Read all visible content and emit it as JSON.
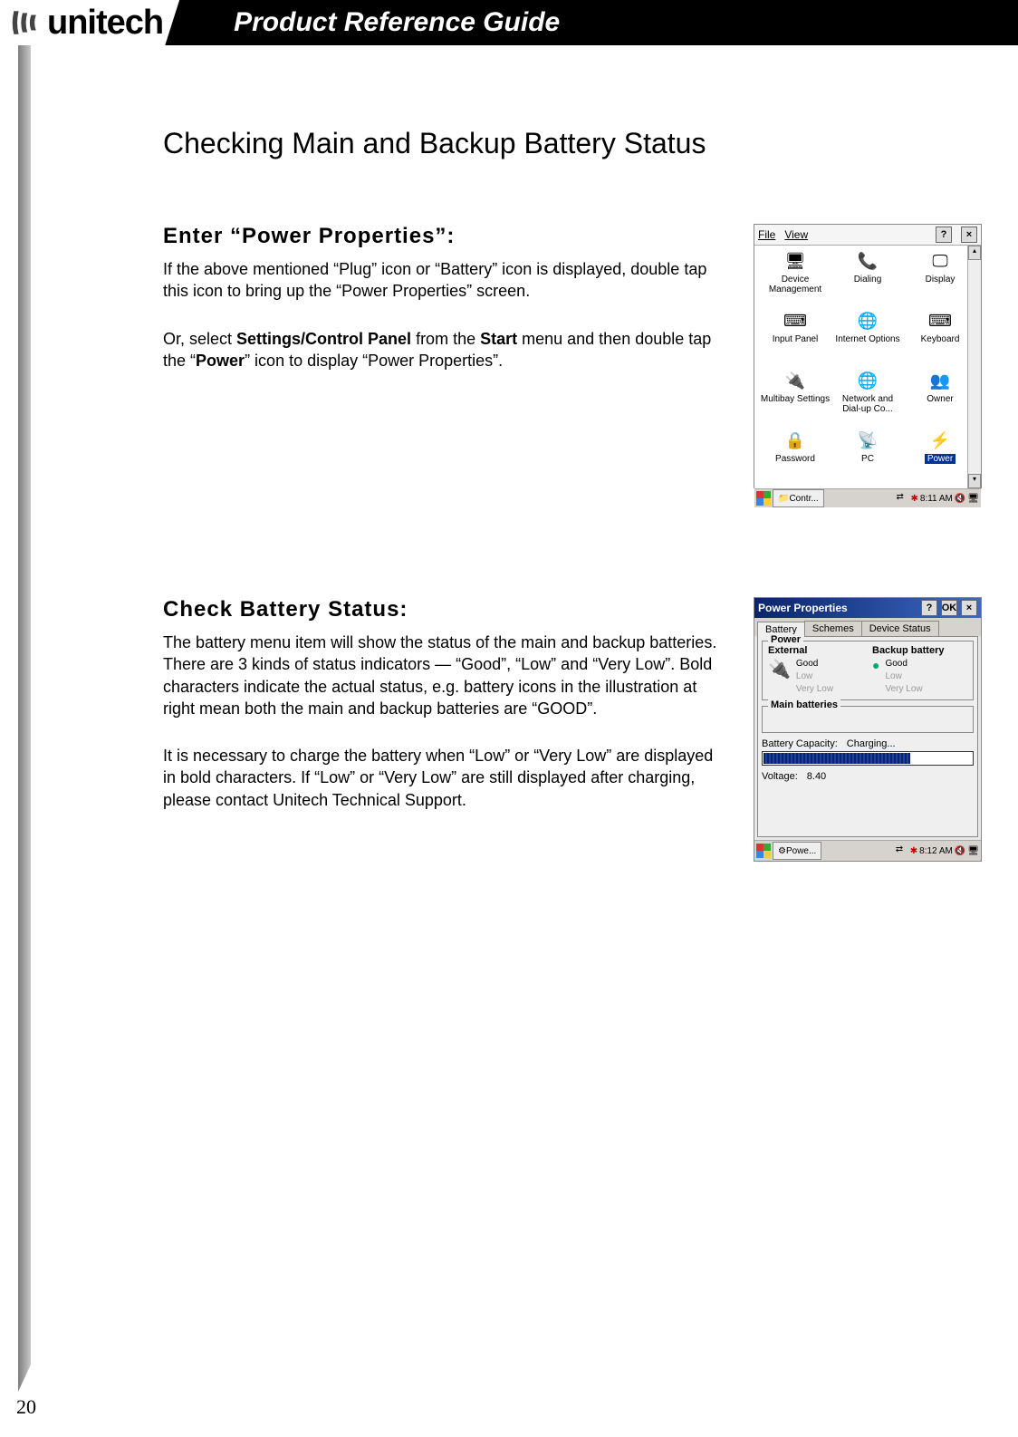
{
  "header": {
    "brand": "unitech",
    "title": "Product Reference Guide"
  },
  "page": {
    "number": "20",
    "heading": "Checking Main and Backup Battery Status"
  },
  "section1": {
    "title": "Enter “Power Properties”:",
    "para1": "If the above mentioned “Plug” icon or “Battery” icon is displayed, double tap this icon to bring up the “Power Properties” screen.",
    "para2_pre": "Or, select ",
    "para2_b1": "Settings/Control Panel",
    "para2_mid": " from the ",
    "para2_b2": "Start",
    "para2_mid2": " menu and then double tap the “",
    "para2_b3": "Power",
    "para2_post": "” icon to display “Power Properties”."
  },
  "section2": {
    "title": "Check Battery Status:",
    "para1": "The battery menu item will show the status of the main and backup batteries.  There are 3 kinds of status indicators — “Good”, “Low” and “Very Low”. Bold characters indicate the actual status, e.g. battery icons in the illustration at right mean both the main and backup batteries are “GOOD”.",
    "para2": "It is necessary to charge the battery when “Low” or “Very Low” are displayed in bold characters.  If “Low” or “Very Low” are still displayed after charging, please contact Unitech Technical Support."
  },
  "shot1": {
    "menu": {
      "file": "File",
      "view": "View",
      "help": "?",
      "close": "×"
    },
    "icons": [
      {
        "label": "Device Management",
        "glyph": "🖥"
      },
      {
        "label": "Dialing",
        "glyph": "📞"
      },
      {
        "label": "Display",
        "glyph": "🖵"
      },
      {
        "label": "Input Panel",
        "glyph": "⌨"
      },
      {
        "label": "Internet Options",
        "glyph": "🌐"
      },
      {
        "label": "Keyboard",
        "glyph": "⌨"
      },
      {
        "label": "Multibay Settings",
        "glyph": "🔌"
      },
      {
        "label": "Network and Dial-up Co...",
        "glyph": "🌐"
      },
      {
        "label": "Owner",
        "glyph": "👥"
      },
      {
        "label": "Password",
        "glyph": "🔒"
      },
      {
        "label": "PC",
        "glyph": "📡"
      },
      {
        "label": "Power",
        "glyph": "⚡",
        "selected": true
      }
    ],
    "taskbar": {
      "app": "Contr...",
      "time": "8:11 AM"
    }
  },
  "shot2": {
    "title": "Power Properties",
    "help": "?",
    "ok": "OK",
    "close": "×",
    "tabs": [
      "Battery",
      "Schemes",
      "Device Status"
    ],
    "legend_power": "Power",
    "external": {
      "title": "External",
      "good": "Good",
      "low": "Low",
      "vlow": "Very Low"
    },
    "backup": {
      "title": "Backup battery",
      "good": "Good",
      "low": "Low",
      "vlow": "Very Low"
    },
    "legend_main": "Main batteries",
    "capacity_label": "Battery Capacity:",
    "capacity_value": "Charging...",
    "voltage_label": "Voltage:",
    "voltage_value": "8.40",
    "taskbar": {
      "app": "Powe...",
      "time": "8:12 AM"
    }
  }
}
